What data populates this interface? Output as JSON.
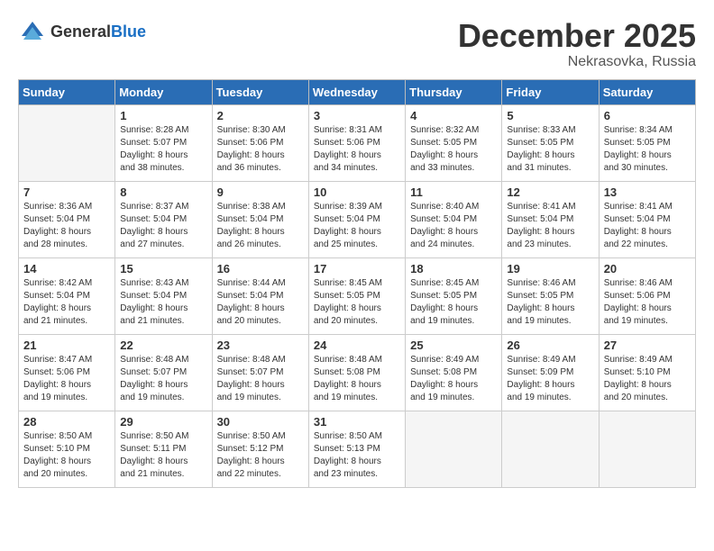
{
  "logo": {
    "general": "General",
    "blue": "Blue"
  },
  "title": {
    "month": "December 2025",
    "location": "Nekrasovka, Russia"
  },
  "headers": [
    "Sunday",
    "Monday",
    "Tuesday",
    "Wednesday",
    "Thursday",
    "Friday",
    "Saturday"
  ],
  "weeks": [
    [
      {
        "day": "",
        "info": ""
      },
      {
        "day": "1",
        "info": "Sunrise: 8:28 AM\nSunset: 5:07 PM\nDaylight: 8 hours\nand 38 minutes."
      },
      {
        "day": "2",
        "info": "Sunrise: 8:30 AM\nSunset: 5:06 PM\nDaylight: 8 hours\nand 36 minutes."
      },
      {
        "day": "3",
        "info": "Sunrise: 8:31 AM\nSunset: 5:06 PM\nDaylight: 8 hours\nand 34 minutes."
      },
      {
        "day": "4",
        "info": "Sunrise: 8:32 AM\nSunset: 5:05 PM\nDaylight: 8 hours\nand 33 minutes."
      },
      {
        "day": "5",
        "info": "Sunrise: 8:33 AM\nSunset: 5:05 PM\nDaylight: 8 hours\nand 31 minutes."
      },
      {
        "day": "6",
        "info": "Sunrise: 8:34 AM\nSunset: 5:05 PM\nDaylight: 8 hours\nand 30 minutes."
      }
    ],
    [
      {
        "day": "7",
        "info": "Sunrise: 8:36 AM\nSunset: 5:04 PM\nDaylight: 8 hours\nand 28 minutes."
      },
      {
        "day": "8",
        "info": "Sunrise: 8:37 AM\nSunset: 5:04 PM\nDaylight: 8 hours\nand 27 minutes."
      },
      {
        "day": "9",
        "info": "Sunrise: 8:38 AM\nSunset: 5:04 PM\nDaylight: 8 hours\nand 26 minutes."
      },
      {
        "day": "10",
        "info": "Sunrise: 8:39 AM\nSunset: 5:04 PM\nDaylight: 8 hours\nand 25 minutes."
      },
      {
        "day": "11",
        "info": "Sunrise: 8:40 AM\nSunset: 5:04 PM\nDaylight: 8 hours\nand 24 minutes."
      },
      {
        "day": "12",
        "info": "Sunrise: 8:41 AM\nSunset: 5:04 PM\nDaylight: 8 hours\nand 23 minutes."
      },
      {
        "day": "13",
        "info": "Sunrise: 8:41 AM\nSunset: 5:04 PM\nDaylight: 8 hours\nand 22 minutes."
      }
    ],
    [
      {
        "day": "14",
        "info": "Sunrise: 8:42 AM\nSunset: 5:04 PM\nDaylight: 8 hours\nand 21 minutes."
      },
      {
        "day": "15",
        "info": "Sunrise: 8:43 AM\nSunset: 5:04 PM\nDaylight: 8 hours\nand 21 minutes."
      },
      {
        "day": "16",
        "info": "Sunrise: 8:44 AM\nSunset: 5:04 PM\nDaylight: 8 hours\nand 20 minutes."
      },
      {
        "day": "17",
        "info": "Sunrise: 8:45 AM\nSunset: 5:05 PM\nDaylight: 8 hours\nand 20 minutes."
      },
      {
        "day": "18",
        "info": "Sunrise: 8:45 AM\nSunset: 5:05 PM\nDaylight: 8 hours\nand 19 minutes."
      },
      {
        "day": "19",
        "info": "Sunrise: 8:46 AM\nSunset: 5:05 PM\nDaylight: 8 hours\nand 19 minutes."
      },
      {
        "day": "20",
        "info": "Sunrise: 8:46 AM\nSunset: 5:06 PM\nDaylight: 8 hours\nand 19 minutes."
      }
    ],
    [
      {
        "day": "21",
        "info": "Sunrise: 8:47 AM\nSunset: 5:06 PM\nDaylight: 8 hours\nand 19 minutes."
      },
      {
        "day": "22",
        "info": "Sunrise: 8:48 AM\nSunset: 5:07 PM\nDaylight: 8 hours\nand 19 minutes."
      },
      {
        "day": "23",
        "info": "Sunrise: 8:48 AM\nSunset: 5:07 PM\nDaylight: 8 hours\nand 19 minutes."
      },
      {
        "day": "24",
        "info": "Sunrise: 8:48 AM\nSunset: 5:08 PM\nDaylight: 8 hours\nand 19 minutes."
      },
      {
        "day": "25",
        "info": "Sunrise: 8:49 AM\nSunset: 5:08 PM\nDaylight: 8 hours\nand 19 minutes."
      },
      {
        "day": "26",
        "info": "Sunrise: 8:49 AM\nSunset: 5:09 PM\nDaylight: 8 hours\nand 19 minutes."
      },
      {
        "day": "27",
        "info": "Sunrise: 8:49 AM\nSunset: 5:10 PM\nDaylight: 8 hours\nand 20 minutes."
      }
    ],
    [
      {
        "day": "28",
        "info": "Sunrise: 8:50 AM\nSunset: 5:10 PM\nDaylight: 8 hours\nand 20 minutes."
      },
      {
        "day": "29",
        "info": "Sunrise: 8:50 AM\nSunset: 5:11 PM\nDaylight: 8 hours\nand 21 minutes."
      },
      {
        "day": "30",
        "info": "Sunrise: 8:50 AM\nSunset: 5:12 PM\nDaylight: 8 hours\nand 22 minutes."
      },
      {
        "day": "31",
        "info": "Sunrise: 8:50 AM\nSunset: 5:13 PM\nDaylight: 8 hours\nand 23 minutes."
      },
      {
        "day": "",
        "info": ""
      },
      {
        "day": "",
        "info": ""
      },
      {
        "day": "",
        "info": ""
      }
    ]
  ]
}
